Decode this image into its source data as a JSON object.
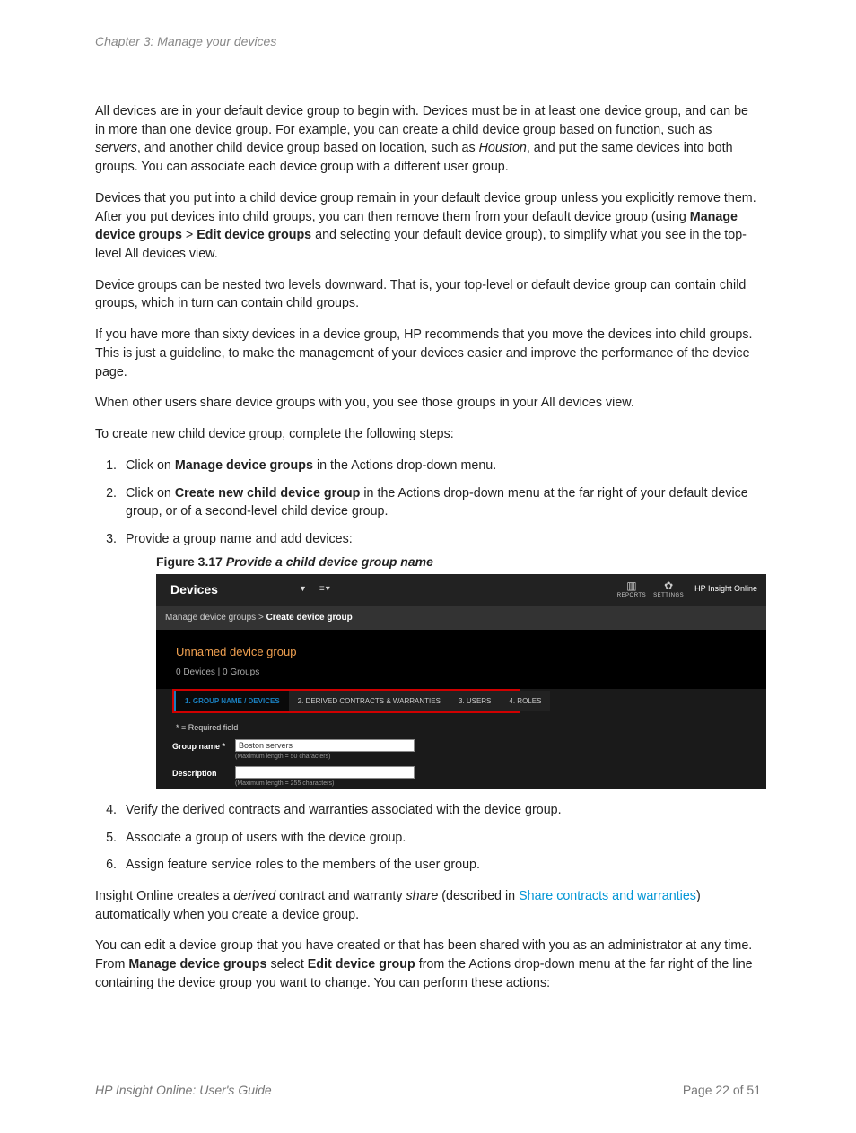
{
  "chapter": "Chapter 3: Manage your devices",
  "p1_a": "All devices are in your default device group to begin with. Devices must be in at least one device group, and can be in more than one device group. For example, you can create a child device group based on function, such as ",
  "p1_i1": "servers",
  "p1_b": ", and another child device group based on location, such as ",
  "p1_i2": "Houston",
  "p1_c": ", and put the same devices into both groups. You can associate each device group with a different user group.",
  "p2_a": "Devices that you put into a child device group remain in your default device group unless you explicitly remove them. After you put devices into child groups, you can then remove them from your default device group (using ",
  "p2_b1": "Manage device groups",
  "p2_gt": " > ",
  "p2_b2": "Edit device groups",
  "p2_b": " and selecting your default device group), to simplify what you see in the top-level All devices view.",
  "p3": "Device groups can be nested two levels downward. That is, your top-level or default device group can contain child groups, which in turn can contain child groups.",
  "p4": "If you have more than sixty devices in a device group, HP recommends that you move the devices into child groups. This is just a guideline, to make the management of your devices easier and improve the performance of the device page.",
  "p5": "When other users share device groups with you, you see those groups in your All devices view.",
  "p6": "To create new child device group, complete the following steps:",
  "s1_a": "Click on ",
  "s1_b": "Manage device groups",
  "s1_c": " in the Actions drop-down menu.",
  "s2_a": "Click on ",
  "s2_b": "Create new child device group",
  "s2_c": " in the Actions drop-down menu at the far right of your default device group, or of a second-level child device group.",
  "s3": "Provide a group name and add devices:",
  "s4": "Verify the derived contracts and warranties associated with the device group.",
  "s5": "Associate a group of users with the device group.",
  "s6": "Assign feature service roles to the members of the user group.",
  "fig_label": "Figure 3.17",
  "fig_title": "Provide a child device group name",
  "fig": {
    "header_title": "Devices",
    "reports": "REPORTS",
    "settings": "SETTINGS",
    "brand": "HP Insight Online",
    "crumb1": "Manage device groups > ",
    "crumb2": "Create device group",
    "group_name_header": "Unnamed device group",
    "counts": "0 Devices | 0 Groups",
    "tab1": "1. GROUP NAME / DEVICES",
    "tab2": "2. DERIVED CONTRACTS & WARRANTIES",
    "tab3": "3. USERS",
    "tab4": "4. ROLES",
    "required": "* = Required field",
    "label_groupname": "Group name *",
    "input_value": "Boston servers",
    "hint1": "(Maximum length = 50 characters)",
    "label_desc": "Description",
    "hint2": "(Maximum length = 255 characters)"
  },
  "p7_a": "Insight Online creates a ",
  "p7_i1": "derived",
  "p7_b": " contract and warranty ",
  "p7_i2": "share",
  "p7_c": " (described in ",
  "p7_link": "Share contracts and warranties",
  "p7_d": ") automatically when you create a device group.",
  "p8_a": "You can edit a device group that you have created or that has been shared with you as an administrator at any time. From ",
  "p8_b1": "Manage device groups",
  "p8_b": " select ",
  "p8_b2": "Edit device group",
  "p8_c": " from the Actions drop-down menu at the far right of the line containing the device group you want to change. You can perform these actions:",
  "footer_left": "HP Insight Online: User's Guide",
  "footer_right": "Page 22 of 51"
}
